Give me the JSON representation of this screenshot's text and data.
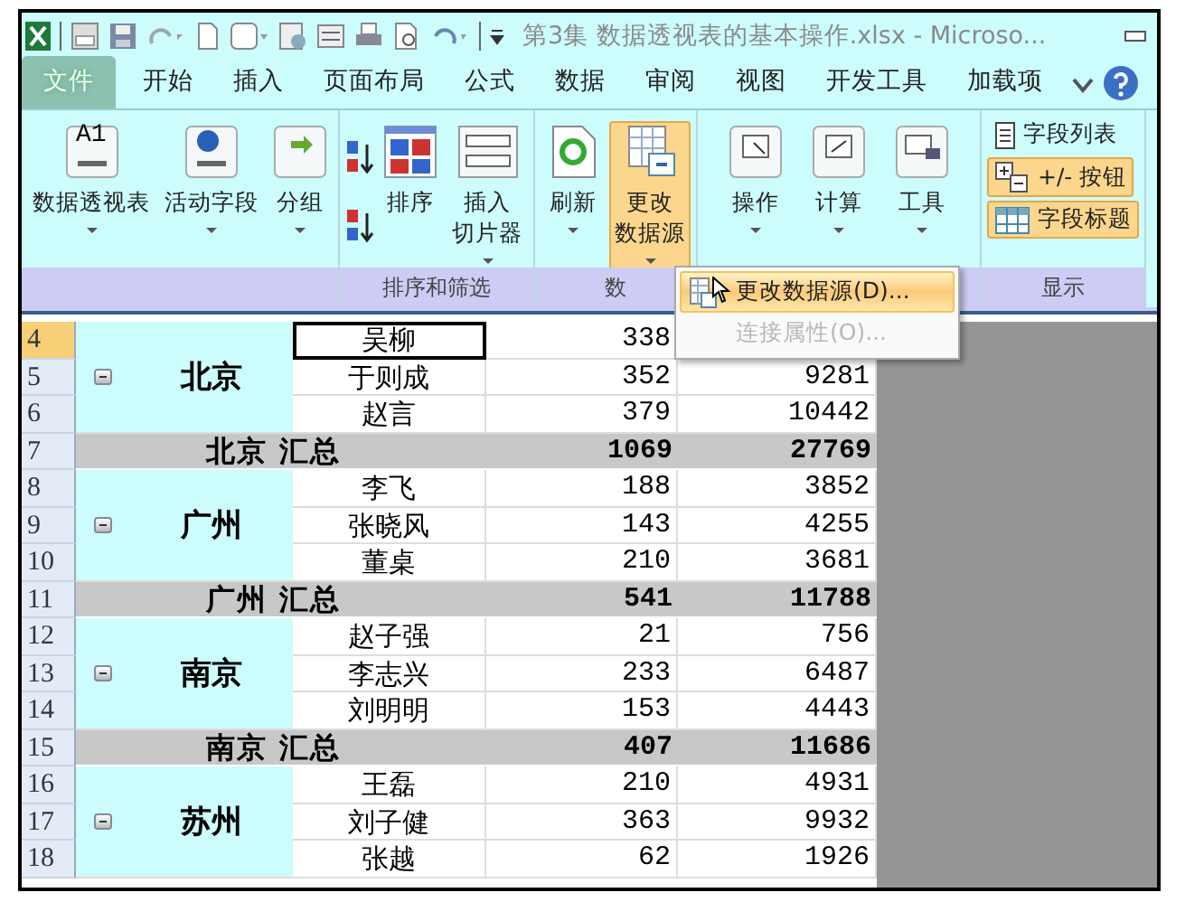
{
  "window": {
    "title": "第3集 数据透视表的基本操作.xlsx  -  Microso..."
  },
  "tabs": [
    {
      "label": "文件",
      "selected": true
    },
    {
      "label": "开始",
      "selected": false
    },
    {
      "label": "插入",
      "selected": false
    },
    {
      "label": "页面布局",
      "selected": false
    },
    {
      "label": "公式",
      "selected": false
    },
    {
      "label": "数据",
      "selected": false
    },
    {
      "label": "审阅",
      "selected": false
    },
    {
      "label": "视图",
      "selected": false
    },
    {
      "label": "开发工具",
      "selected": false
    },
    {
      "label": "加载项",
      "selected": false
    }
  ],
  "name_box": "A1",
  "ribbon": {
    "groups": [
      {
        "buttons": [
          {
            "kind": "pivot",
            "label": [
              "数据透视表"
            ],
            "dropdown": true,
            "active": false
          },
          {
            "kind": "field",
            "label": [
              "活动字段"
            ],
            "dropdown": true,
            "active": false
          },
          {
            "kind": "group",
            "label": [
              "分组"
            ],
            "dropdown": true,
            "active": false
          }
        ]
      },
      {
        "label": "排序和筛选",
        "buttons": [
          {
            "kind": "sort_pair"
          },
          {
            "kind": "sort",
            "label": [
              "排序"
            ],
            "dropdown": false,
            "active": false
          },
          {
            "kind": "slicer",
            "label": [
              "插入",
              "切片器"
            ],
            "dropdown": true,
            "active": false
          }
        ]
      },
      {
        "label": "数",
        "buttons": [
          {
            "kind": "refresh",
            "label": [
              "刷新"
            ],
            "dropdown": true,
            "active": false
          },
          {
            "kind": "datasource",
            "label": [
              "更改",
              "数据源"
            ],
            "dropdown": true,
            "active": true
          }
        ]
      },
      {
        "buttons": [
          {
            "kind": "action",
            "label": [
              "操作"
            ],
            "dropdown": true,
            "active": false
          },
          {
            "kind": "calc",
            "label": [
              "计算"
            ],
            "dropdown": true,
            "active": false
          },
          {
            "kind": "tool",
            "label": [
              "工具"
            ],
            "dropdown": true,
            "active": false
          }
        ]
      },
      {
        "label": "显示",
        "buttons": [
          {
            "kind": "fieldlist",
            "label": [
              "字段列表"
            ],
            "dropdown": false,
            "active": false
          },
          {
            "kind": "plusminus",
            "label": [
              "+/- 按钮"
            ],
            "dropdown": false,
            "active": true
          },
          {
            "kind": "headers",
            "label": [
              "字段标题"
            ],
            "dropdown": false,
            "active": true
          }
        ]
      }
    ]
  },
  "menu": {
    "items": [
      {
        "label": "更改数据源(D)...",
        "highlighted": true,
        "disabled": false
      },
      {
        "label": "连接属性(O)...",
        "highlighted": false,
        "disabled": true
      }
    ]
  },
  "table": {
    "groups": [
      {
        "city": "北京",
        "expanded": true,
        "rows": [
          {
            "row": "4",
            "name": "吴柳",
            "qty": "338",
            "selected": true
          },
          {
            "row": "5",
            "name": "于则成",
            "qty": "352",
            "amount": "9281",
            "selected": false
          },
          {
            "row": "6",
            "name": "赵言",
            "qty": "379",
            "amount": "10442",
            "selected": false
          }
        ],
        "total": {
          "row": "7",
          "label": "北京 汇总",
          "qty": "1069",
          "amount": "27769"
        }
      },
      {
        "city": "广州",
        "expanded": true,
        "rows": [
          {
            "row": "8",
            "name": "李飞",
            "qty": "188",
            "amount": "3852",
            "selected": false
          },
          {
            "row": "9",
            "name": "张晓风",
            "qty": "143",
            "amount": "4255",
            "selected": false
          },
          {
            "row": "10",
            "name": "董桌",
            "qty": "210",
            "amount": "3681",
            "selected": false
          }
        ],
        "total": {
          "row": "11",
          "label": "广州 汇总",
          "qty": "541",
          "amount": "11788"
        }
      },
      {
        "city": "南京",
        "expanded": true,
        "rows": [
          {
            "row": "12",
            "name": "赵子强",
            "qty": "21",
            "amount": "756",
            "selected": false
          },
          {
            "row": "13",
            "name": "李志兴",
            "qty": "233",
            "amount": "6487",
            "selected": false
          },
          {
            "row": "14",
            "name": "刘明明",
            "qty": "153",
            "amount": "4443",
            "selected": false
          }
        ],
        "total": {
          "row": "15",
          "label": "南京 汇总",
          "qty": "407",
          "amount": "11686"
        }
      },
      {
        "city": "苏州",
        "expanded": true,
        "rows": [
          {
            "row": "16",
            "name": "王磊",
            "qty": "210",
            "amount": "4931",
            "selected": false
          },
          {
            "row": "17",
            "name": "刘子健",
            "qty": "363",
            "amount": "9932",
            "selected": false
          },
          {
            "row": "18",
            "name": "张越",
            "qty": "62",
            "amount": "1926",
            "selected": false
          }
        ]
      }
    ]
  }
}
